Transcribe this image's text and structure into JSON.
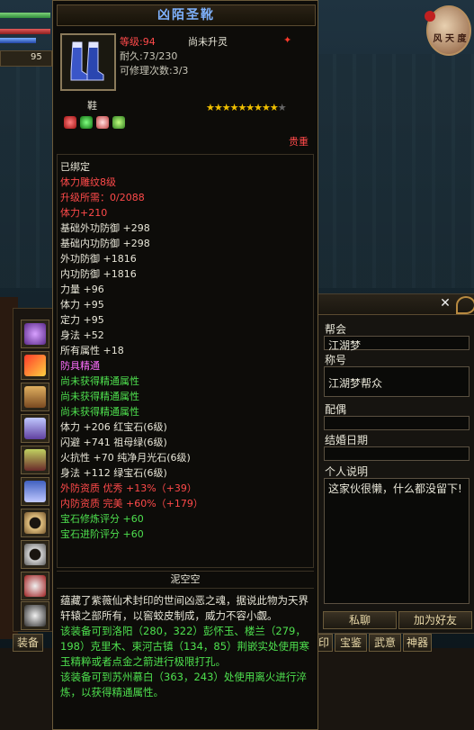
{
  "hud": {
    "level_number": "95"
  },
  "emblem": {
    "text": "风 天 度"
  },
  "tooltip": {
    "title": "凶陌圣靴",
    "level": "等级:94",
    "upgrade_state": "尚未升灵",
    "durability": "耐久:73/230",
    "repair_count": "可修理次数:3/3",
    "type": "鞋",
    "quality": "贵重",
    "stars_on": "★★★★★★★★★",
    "stars_off": "★",
    "stats": [
      {
        "text": "已绑定",
        "color": "white"
      },
      {
        "text": "体力雕纹8级",
        "color": "red"
      },
      {
        "text": "升级所需：0/2088",
        "color": "red"
      },
      {
        "text": "体力+210",
        "color": "red"
      },
      {
        "text": "基础外功防御 +298",
        "color": "white"
      },
      {
        "text": "基础内功防御 +298",
        "color": "white"
      },
      {
        "text": "外功防御 +1816",
        "color": "white"
      },
      {
        "text": "内功防御 +1816",
        "color": "white"
      },
      {
        "text": "力量 +96",
        "color": "white"
      },
      {
        "text": "体力 +95",
        "color": "white"
      },
      {
        "text": "定力 +95",
        "color": "white"
      },
      {
        "text": "身法 +52",
        "color": "white"
      },
      {
        "text": "所有属性 +18",
        "color": "white"
      },
      {
        "text": "防具精通",
        "color": "pink"
      },
      {
        "text": "尚未获得精通属性",
        "color": "green"
      },
      {
        "text": "尚未获得精通属性",
        "color": "green"
      },
      {
        "text": "尚未获得精通属性",
        "color": "green"
      },
      {
        "text": "体力 +206 红宝石(6级)",
        "color": "white"
      },
      {
        "text": "闪避 +741 祖母绿(6级)",
        "color": "white"
      },
      {
        "text": "火抗性 +70 纯净月光石(6级)",
        "color": "white"
      },
      {
        "text": "身法 +112 绿宝石(6级)",
        "color": "white"
      },
      {
        "text": "外防资质  优秀 +13%（+39）",
        "color": "red"
      },
      {
        "text": "内防资质  完美 +60%（+179）",
        "color": "red"
      },
      {
        "text": "宝石修炼评分 +60",
        "color": "green"
      },
      {
        "text": "宝石进阶评分 +60",
        "color": "green"
      }
    ],
    "maker": "泥空空",
    "description": "蕴藏了紫薇仙术封印的世间凶恶之魂，据说此物为天界轩辕之部所有，以窖蛟皮制成，威力不容小觑。",
    "hint1": "该装备可到洛阳（280，322）彭怀玉、楼兰（279，198）克里木、束河古镇（134，85）荆嵌实处使用寒玉精粹或者点金之箭进行极限打孔。",
    "hint2": "该装备可到苏州慕白（363，243）处使用离火进行淬炼，以获得精通属性。"
  },
  "side_panel": {
    "guild_label": "帮会",
    "guild_value": "江湖梦",
    "title_label": "称号",
    "title_value": "江湖梦帮众",
    "spouse_label": "配偶",
    "spouse_value": "",
    "wedding_label": "结婚日期",
    "wedding_value": "",
    "bio_label": "个人说明",
    "bio_value": "这家伙很懒，什么都没留下!",
    "chat_button": "私聊",
    "add_friend_button": "加为好友"
  },
  "bottom_tabs": {
    "equip": "装备",
    "mark": "印",
    "gem": "宝鉴",
    "wuyi": "武意",
    "shenqi": "神器"
  },
  "colors": {
    "title_blue": "#7fb2ff",
    "red": "#ff4a4a",
    "green": "#4ee04e",
    "pink": "#ff70ff",
    "gold": "#f0c000"
  }
}
